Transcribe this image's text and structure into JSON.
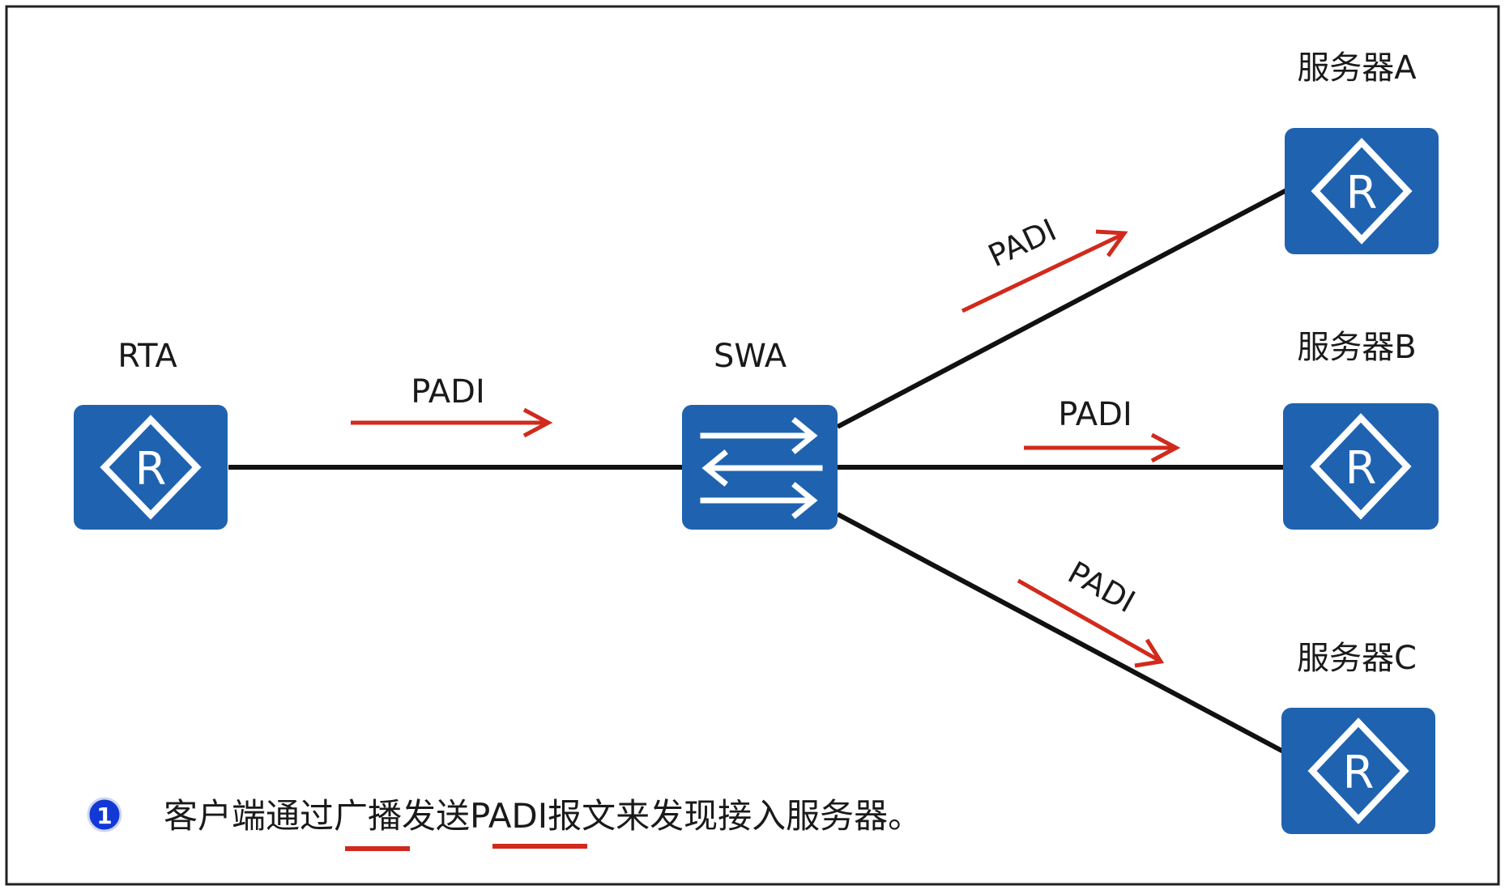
{
  "nodes": {
    "rta": {
      "label": "RTA",
      "kind": "router"
    },
    "swa": {
      "label": "SWA",
      "kind": "switch"
    },
    "server_a": {
      "label": "服务器A",
      "kind": "router"
    },
    "server_b": {
      "label": "服务器B",
      "kind": "router"
    },
    "server_c": {
      "label": "服务器C",
      "kind": "router"
    }
  },
  "messages": {
    "rta_to_swa": "PADI",
    "swa_to_a": "PADI",
    "swa_to_b": "PADI",
    "swa_to_c": "PADI"
  },
  "router_glyph": "R",
  "caption": {
    "step_number": "1",
    "segments": [
      "客户端通过",
      "广播",
      "发送",
      "PADI",
      "报文来发现接入服务器。"
    ],
    "underlined_terms": [
      "广播",
      "PADI"
    ]
  },
  "colors": {
    "device_blue": "#1f63b0",
    "arrow_red": "#d12a1c",
    "line_black": "#111111",
    "badge_blue": "#1238d6"
  }
}
